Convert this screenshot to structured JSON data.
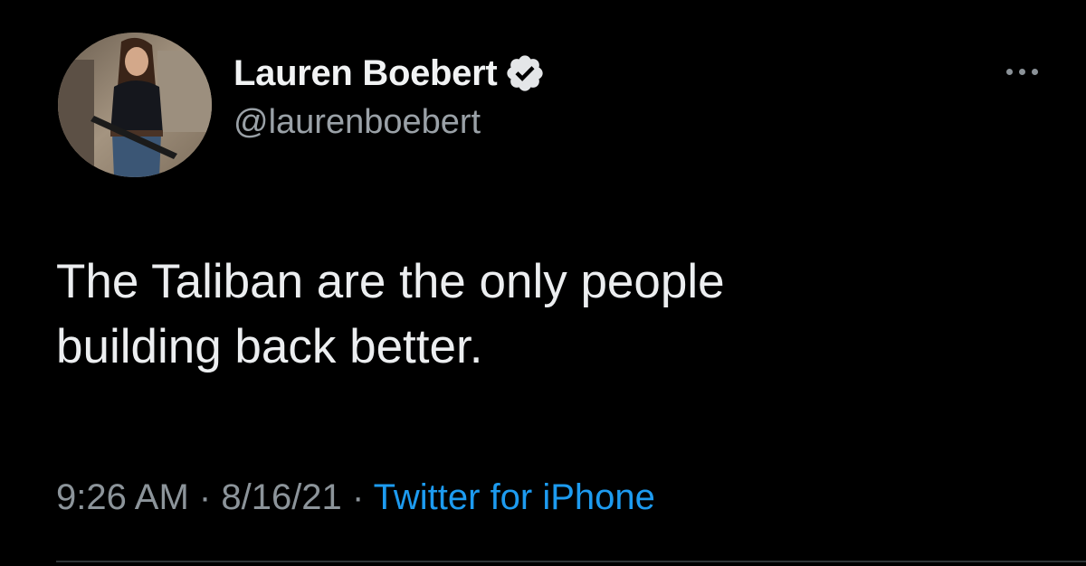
{
  "user": {
    "display_name": "Lauren Boebert",
    "handle": "@laurenboebert",
    "verified": true
  },
  "tweet": {
    "lines": [
      "The Taliban are the only people",
      "building back better."
    ],
    "time": "9:26 AM",
    "separator": "·",
    "date": "8/16/21",
    "source": "Twitter for iPhone"
  },
  "icons": {
    "verified": "verified-badge-icon",
    "more": "more-options-icon"
  },
  "colors": {
    "background": "#000000",
    "text": "#e7e9ea",
    "secondary": "#8c949a",
    "link": "#1d9bf0"
  }
}
